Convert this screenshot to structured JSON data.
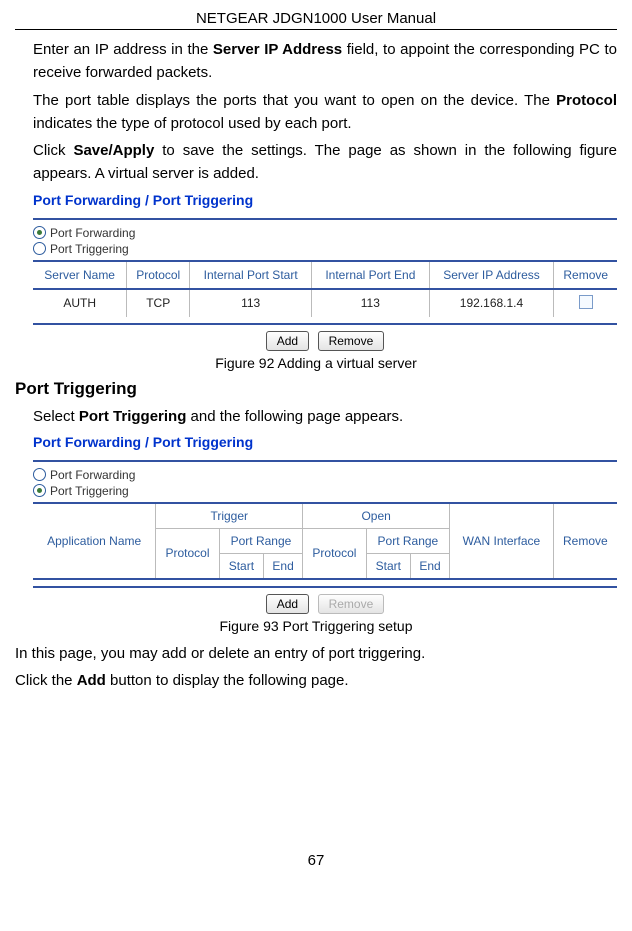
{
  "header": {
    "title": "NETGEAR JDGN1000 User Manual"
  },
  "para1": {
    "prefix": "Enter an IP address in the ",
    "bold": "Server IP Address",
    "suffix": " field, to appoint the corresponding PC to receive forwarded packets."
  },
  "para2": {
    "prefix": "The port table displays the ports that you want to open on the device. The ",
    "bold": "Protocol",
    "suffix": " indicates the type of protocol used by each port."
  },
  "para3": {
    "prefix": "Click ",
    "bold": "Save/Apply",
    "suffix": " to save the settings. The page as shown in the following figure appears. A virtual server is added."
  },
  "figure1": {
    "title": "Port Forwarding / Port Triggering",
    "radio1": "Port Forwarding",
    "radio2": "Port Triggering",
    "headers": {
      "server": "Server Name",
      "protocol": "Protocol",
      "ipstart": "Internal Port Start",
      "ipend": "Internal Port End",
      "ipaddr": "Server IP Address",
      "remove": "Remove"
    },
    "row": {
      "server": "AUTH",
      "protocol": "TCP",
      "ipstart": "113",
      "ipend": "113",
      "ipaddr": "192.168.1.4"
    },
    "add": "Add",
    "remove": "Remove",
    "caption": "Figure 92 Adding a virtual server"
  },
  "section2": {
    "title": "Port Triggering",
    "para_prefix": "Select ",
    "para_bold": "Port Triggering",
    "para_suffix": " and the following page appears."
  },
  "figure2": {
    "title": "Port Forwarding / Port Triggering",
    "radio1": "Port Forwarding",
    "radio2": "Port Triggering",
    "headers": {
      "app": "Application Name",
      "trigger": "Trigger",
      "open": "Open",
      "protocol": "Protocol",
      "portrange": "Port Range",
      "start": "Start",
      "end": "End",
      "wan": "WAN Interface",
      "remove": "Remove"
    },
    "add": "Add",
    "remove": "Remove",
    "caption": "Figure 93 Port Triggering setup"
  },
  "para4": "In this page, you may add or delete an entry of port triggering.",
  "para5": {
    "prefix": "Click the ",
    "bold": "Add",
    "suffix": " button to display the following page."
  },
  "pagenum": "67"
}
